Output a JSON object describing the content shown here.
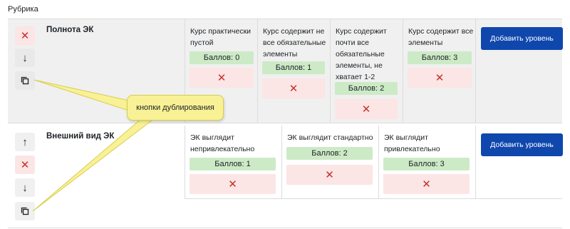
{
  "rubric_label": "Рубрика",
  "add_level_label": "Добавить уровень",
  "criteria": [
    {
      "title": "Полнота ЭК",
      "levels": [
        {
          "description": "Курс практически пустой",
          "score": "Баллов: 0"
        },
        {
          "description": "Курс содержит не все обязательные элементы",
          "score": "Баллов: 1"
        },
        {
          "description": "Курс содержит почти все обязательные элементы, не хватает 1-2",
          "score": "Баллов: 2"
        },
        {
          "description": "Курс содержит все элементы",
          "score": "Баллов: 3"
        }
      ]
    },
    {
      "title": "Внешний вид ЭК",
      "levels": [
        {
          "description": "ЭК выглядит непривлекательно",
          "score": "Баллов: 1"
        },
        {
          "description": "ЭК выглядит стандартно",
          "score": "Баллов: 2"
        },
        {
          "description": "ЭК выглядит привлекательно",
          "score": "Баллов: 3"
        }
      ]
    }
  ],
  "callout_text": "кнопки дублирования",
  "icons": {
    "delete": "close-icon",
    "move_down": "arrow-down-icon",
    "move_up": "arrow-up-icon",
    "duplicate": "copy-icon"
  },
  "colors": {
    "accent": "#0f47ad",
    "score_bg": "#cdeac7",
    "delete_bg": "#fbe5e5",
    "delete_fg": "#c9302c",
    "callout_bg": "#f9f196"
  }
}
